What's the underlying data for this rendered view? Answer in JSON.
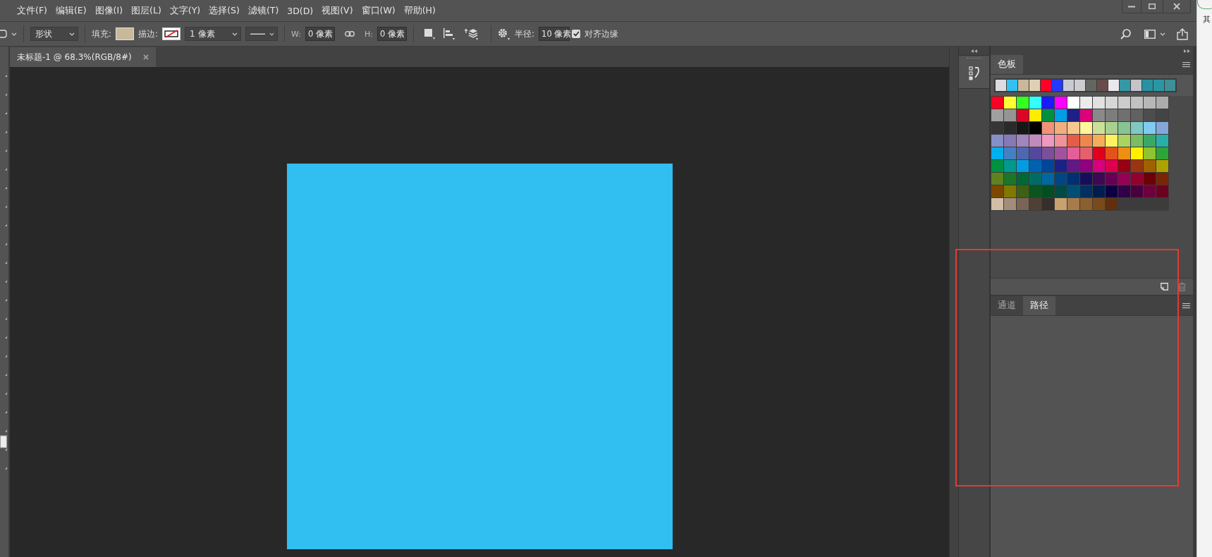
{
  "menu": [
    {
      "label": "文件(F)"
    },
    {
      "label": "编辑(E)"
    },
    {
      "label": "图像(I)"
    },
    {
      "label": "图层(L)"
    },
    {
      "label": "文字(Y)"
    },
    {
      "label": "选择(S)"
    },
    {
      "label": "滤镜(T)"
    },
    {
      "label": "3D(D)"
    },
    {
      "label": "视图(V)"
    },
    {
      "label": "窗口(W)"
    },
    {
      "label": "帮助(H)"
    }
  ],
  "options_bar": {
    "mode": "形状",
    "fill": {
      "label": "填充:",
      "color": "#c8b99a"
    },
    "stroke": {
      "label": "描边:"
    },
    "stroke_width": "1 像素",
    "width": {
      "label": "W:",
      "value": "0 像素"
    },
    "height": {
      "label": "H:",
      "value": "0 像素"
    },
    "radius": {
      "label": "半径:",
      "value": "10 像素"
    },
    "snap": {
      "label": "对齐边缘",
      "checked": true
    }
  },
  "document_tab": {
    "title": "未标题-1 @ 68.3%(RGB/8#)"
  },
  "canvas": {
    "shape": {
      "color": "#31bef1"
    }
  },
  "swatches_panel": {
    "tabs": [
      {
        "label": "色板",
        "selected": true
      }
    ],
    "recent": [
      {
        "color": "#dcdce0"
      },
      {
        "color": "#33c0f3"
      },
      {
        "color": "#c8b99a"
      },
      {
        "color": "#dfd0b5"
      },
      {
        "color": "#ff0027"
      },
      {
        "color": "#2439ff"
      },
      {
        "color": "#cacbd0"
      },
      {
        "color": "#cdcdd1"
      },
      {
        "color": "#626660"
      },
      {
        "color": "#6a4b4c"
      },
      {
        "color": "#e9e8ec"
      },
      {
        "color": "#3399a5"
      },
      {
        "color": "#c4c3c9"
      },
      {
        "color": "#2892a0"
      },
      {
        "color": "#2b97a5"
      },
      {
        "color": "#3d8f98"
      }
    ],
    "swatches": [
      {
        "color": "#ff0022"
      },
      {
        "color": "#ffff33"
      },
      {
        "color": "#33ff22"
      },
      {
        "color": "#33ffff"
      },
      {
        "color": "#1a1aff"
      },
      {
        "color": "#ff00ff"
      },
      {
        "color": "#ffffff"
      },
      {
        "color": "#ebebeb"
      },
      {
        "color": "#e1e1e1"
      },
      {
        "color": "#d7d7d7"
      },
      {
        "color": "#cccccc"
      },
      {
        "color": "#c2c2c2"
      },
      {
        "color": "#b7b7b7"
      },
      {
        "color": "#acacac"
      },
      {
        "color": "#a0a0a0"
      },
      {
        "color": "#959595"
      },
      {
        "color": "#dc0526"
      },
      {
        "color": "#ffec00"
      },
      {
        "color": "#00913f"
      },
      {
        "color": "#009ee5"
      },
      {
        "color": "#1d2087"
      },
      {
        "color": "#dc007a"
      },
      {
        "color": "#898989"
      },
      {
        "color": "#7d7d7d"
      },
      {
        "color": "#707070"
      },
      {
        "color": "#616161"
      },
      {
        "color": "#4d4d4d"
      },
      {
        "color": "#444444"
      },
      {
        "color": "#363636"
      },
      {
        "color": "#2a2a2a"
      },
      {
        "color": "#171717"
      },
      {
        "color": "#000000"
      },
      {
        "color": "#f19178"
      },
      {
        "color": "#f4ad7f"
      },
      {
        "color": "#f7c88e"
      },
      {
        "color": "#fff59b"
      },
      {
        "color": "#cce198"
      },
      {
        "color": "#a9d18e"
      },
      {
        "color": "#86c493"
      },
      {
        "color": "#80c8c4"
      },
      {
        "color": "#7ecaf0"
      },
      {
        "color": "#84a6d8"
      },
      {
        "color": "#8490c6"
      },
      {
        "color": "#8779b6"
      },
      {
        "color": "#a185bc"
      },
      {
        "color": "#c18abb"
      },
      {
        "color": "#ef98c0"
      },
      {
        "color": "#f19199"
      },
      {
        "color": "#e65d47"
      },
      {
        "color": "#ef874c"
      },
      {
        "color": "#f5ae57"
      },
      {
        "color": "#fff162"
      },
      {
        "color": "#abd361"
      },
      {
        "color": "#7cbc63"
      },
      {
        "color": "#39a965"
      },
      {
        "color": "#28afa9"
      },
      {
        "color": "#00b0ec"
      },
      {
        "color": "#4481c3"
      },
      {
        "color": "#4d68b0"
      },
      {
        "color": "#55489c"
      },
      {
        "color": "#7a4f9c"
      },
      {
        "color": "#a1549d"
      },
      {
        "color": "#e45e9a"
      },
      {
        "color": "#e75e6e"
      },
      {
        "color": "#e0001d"
      },
      {
        "color": "#e4521c"
      },
      {
        "color": "#ef8f12"
      },
      {
        "color": "#fff000"
      },
      {
        "color": "#8fc32f"
      },
      {
        "color": "#2ea538"
      },
      {
        "color": "#009142"
      },
      {
        "color": "#009a8e"
      },
      {
        "color": "#009de3"
      },
      {
        "color": "#0062b1"
      },
      {
        "color": "#00469b"
      },
      {
        "color": "#1d2087"
      },
      {
        "color": "#601985"
      },
      {
        "color": "#910081"
      },
      {
        "color": "#d8007d"
      },
      {
        "color": "#dd004e"
      },
      {
        "color": "#9a0012"
      },
      {
        "color": "#9a3510"
      },
      {
        "color": "#a06100"
      },
      {
        "color": "#aea200"
      },
      {
        "color": "#5f821e"
      },
      {
        "color": "#1c7627"
      },
      {
        "color": "#006834"
      },
      {
        "color": "#006b64"
      },
      {
        "color": "#0068a0"
      },
      {
        "color": "#004683"
      },
      {
        "color": "#003072"
      },
      {
        "color": "#170e5b"
      },
      {
        "color": "#3d0855"
      },
      {
        "color": "#650055"
      },
      {
        "color": "#950054"
      },
      {
        "color": "#940030"
      },
      {
        "color": "#6c0009"
      },
      {
        "color": "#7a2505"
      },
      {
        "color": "#7c4800"
      },
      {
        "color": "#817800"
      },
      {
        "color": "#3e6013"
      },
      {
        "color": "#0b541d"
      },
      {
        "color": "#004e21"
      },
      {
        "color": "#004b44"
      },
      {
        "color": "#004e73"
      },
      {
        "color": "#003160"
      },
      {
        "color": "#001d4e"
      },
      {
        "color": "#0c0043"
      },
      {
        "color": "#310046"
      },
      {
        "color": "#48003e"
      },
      {
        "color": "#6e003d"
      },
      {
        "color": "#6c0020"
      },
      {
        "color": "#d2bea6"
      },
      {
        "color": "#a18d7a"
      },
      {
        "color": "#7a6453"
      },
      {
        "color": "#4f4035"
      },
      {
        "color": "#362e2a"
      },
      {
        "color": "#c9a171"
      },
      {
        "color": "#a77b4c"
      },
      {
        "color": "#8c5f30"
      },
      {
        "color": "#7a4a1b"
      },
      {
        "color": "#60300e"
      }
    ]
  },
  "paths_panel": {
    "tabs": [
      {
        "label": "通道",
        "selected": false
      },
      {
        "label": "路径",
        "selected": true
      }
    ]
  },
  "background_window": {
    "text": "其"
  }
}
